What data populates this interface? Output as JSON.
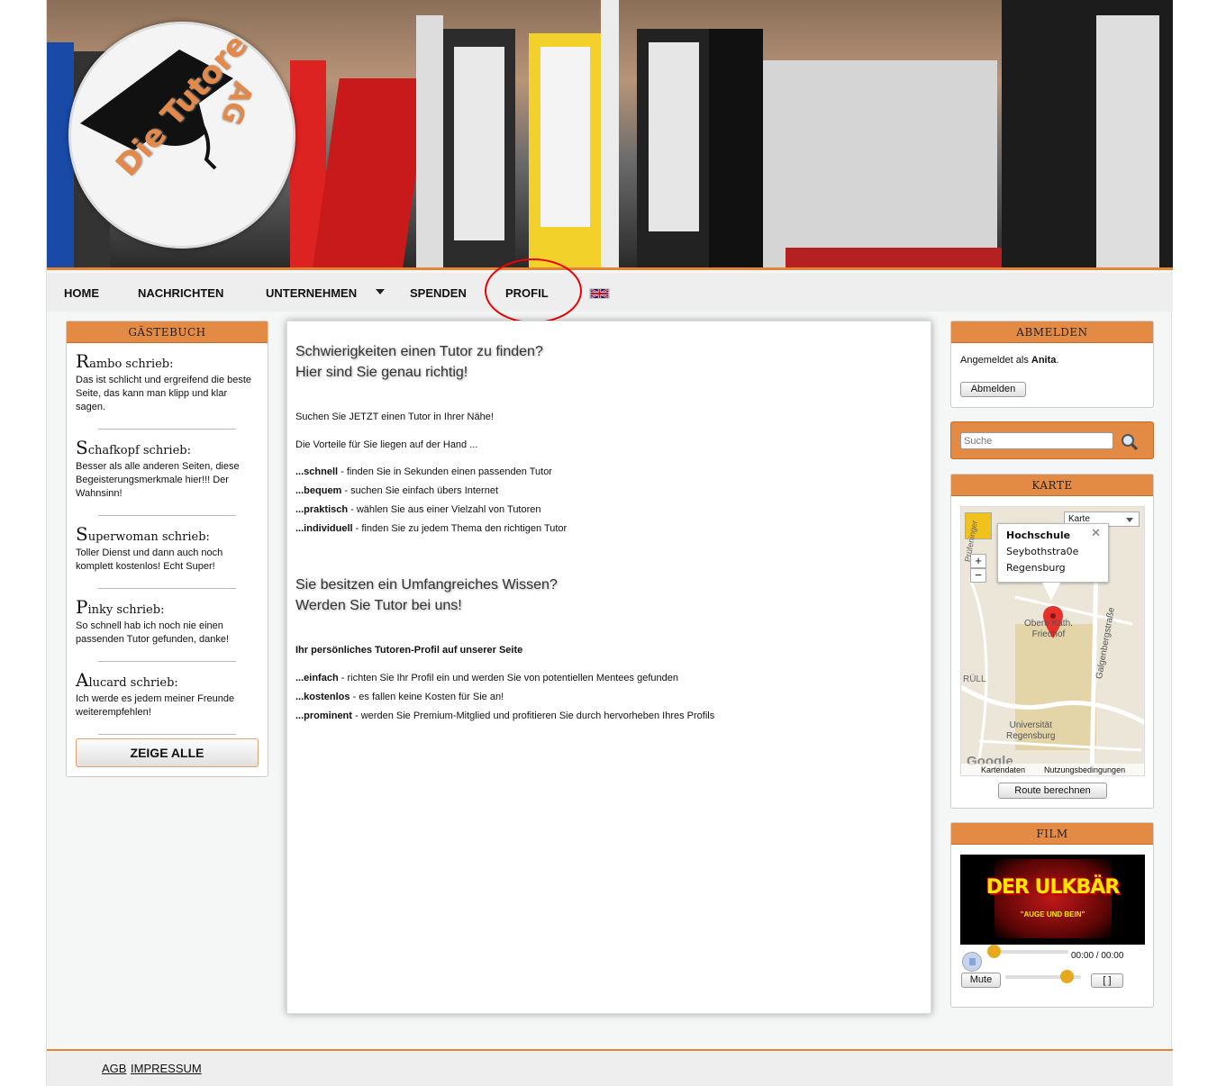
{
  "logo": {
    "text_line1": "Die Tutoren",
    "text_line2": "AG"
  },
  "nav": {
    "items": [
      {
        "label": "HOME"
      },
      {
        "label": "NACHRICHTEN"
      },
      {
        "label": "UNTERNEHMEN"
      },
      {
        "label": "SPENDEN"
      },
      {
        "label": "PROFIL"
      }
    ],
    "language_icon": "uk-flag-icon"
  },
  "guestbook": {
    "title": "GÄSTEBUCH",
    "entries": [
      {
        "initial": "R",
        "name_rest": "ambo schrieb:",
        "text": "Das ist schlicht und ergreifend die beste Seite, das kann man klipp und klar sagen."
      },
      {
        "initial": "S",
        "name_rest": "chafkopf schrieb:",
        "text": "Besser als alle anderen Seiten, diese Begeisterungsmerkmale hier!!! Der Wahnsinn!"
      },
      {
        "initial": "S",
        "name_rest": "uperwoman schrieb:",
        "text": "Toller Dienst und dann auch noch komplett kostenlos! Echt Super!"
      },
      {
        "initial": "P",
        "name_rest": "inky schrieb:",
        "text": "So schnell hab ich noch nie einen passenden Tutor gefunden, danke!"
      },
      {
        "initial": "A",
        "name_rest": "lucard schrieb:",
        "text": "Ich werde es jedem meiner Freunde weiterempfehlen!"
      }
    ],
    "show_all": "ZEIGE ALLE"
  },
  "main": {
    "heading1_line1": "Schwierigkeiten einen Tutor zu finden?",
    "heading1_line2": "Hier sind Sie genau richtig!",
    "intro1": "Suchen Sie JETZT einen Tutor in Ihrer Nähe!",
    "intro2": "Die Vorteile für Sie liegen auf der Hand ...",
    "benefits": [
      {
        "bold": "...schnell",
        "text": " - finden Sie in Sekunden einen passenden Tutor"
      },
      {
        "bold": "...bequem",
        "text": " - suchen Sie einfach übers Internet"
      },
      {
        "bold": "...praktisch",
        "text": " - wählen Sie aus einer Vielzahl von Tutoren"
      },
      {
        "bold": "...individuell",
        "text": " - finden Sie zu jedem Thema den richtigen Tutor"
      }
    ],
    "heading2_line1": "Sie besitzen ein Umfangreiches Wissen?",
    "heading2_line2": "Werden Sie Tutor bei uns!",
    "profile_title": "Ihr persönliches Tutoren-Profil auf unserer Seite",
    "profile_benefits": [
      {
        "bold": "...einfach",
        "text": " - richten Sie Ihr Profil ein und werden Sie von potentiellen Mentees gefunden"
      },
      {
        "bold": "...kostenlos",
        "text": " - es fallen keine Kosten für Sie an!"
      },
      {
        "bold": "...prominent",
        "text": " - werden Sie Premium-Mitglied und profitieren Sie durch hervorheben Ihres Profils"
      }
    ]
  },
  "logout": {
    "title": "ABMELDEN",
    "logged_in_prefix": "Angemeldet als ",
    "user": "Anita",
    "suffix": ".",
    "button": "Abmelden"
  },
  "search": {
    "placeholder": "Suche"
  },
  "map": {
    "title": "KARTE",
    "type_select": "Karte",
    "popup_title": "Hochschule",
    "popup_line2": "Seybothstra0e",
    "popup_line3": "Regensburg",
    "label_friedhof_1": "Obere Kath.",
    "label_friedhof_2": "Friedhof",
    "label_street": "Galgenbergstraße",
    "label_uni_1": "Universität",
    "label_uni_2": "Regensburg",
    "label_left_top": "Prüfeninger",
    "label_left_mid": "RÜLL",
    "attribution_data": "Kartendaten",
    "attribution_terms": "Nutzungsbedingungen",
    "google": "Google",
    "zoom_in": "+",
    "zoom_out": "−",
    "route_button": "Route berechnen"
  },
  "film": {
    "title": "FILM",
    "video_title": "DER ULKBÄR",
    "video_subtitle": "\"AUGE UND BEIN\"",
    "time": "00:00 / 00:00",
    "mute": "Mute",
    "fullscreen": "[ ]",
    "progress": 0,
    "volume": 0.8
  },
  "footer": {
    "links": [
      {
        "label": "AGB"
      },
      {
        "label": "IMPRESSUM"
      }
    ]
  },
  "colors": {
    "accent": "#e38a44",
    "nav_bg": "#eeeeee",
    "highlight_circle": "#e00000"
  }
}
